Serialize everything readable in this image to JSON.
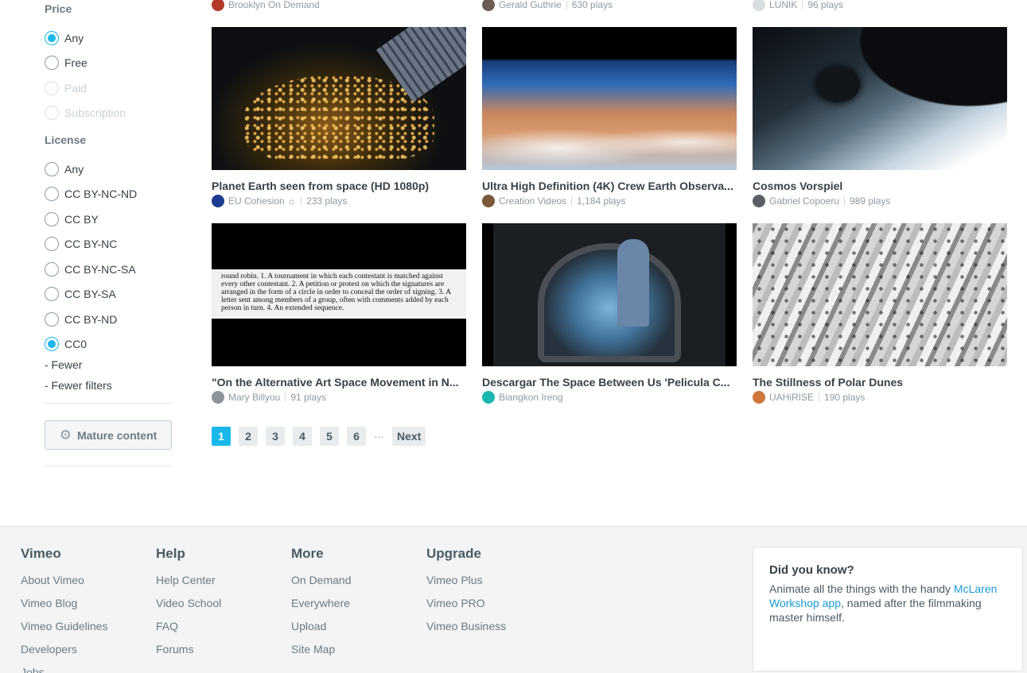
{
  "sidebar": {
    "price_title": "Price",
    "price_options": [
      "Any",
      "Free",
      "Paid",
      "Subscription"
    ],
    "license_title": "License",
    "license_options": [
      "Any",
      "CC BY-NC-ND",
      "CC BY",
      "CC BY-NC",
      "CC BY-NC-SA",
      "CC BY-SA",
      "CC BY-ND",
      "CC0"
    ],
    "fewer": "- Fewer",
    "fewer_filters": "- Fewer filters",
    "mature_button": "Mature content"
  },
  "top_row": [
    {
      "creator": "Brooklyn On Demand",
      "plays": ""
    },
    {
      "creator": "Gerald Guthrie",
      "plays": "630 plays"
    },
    {
      "creator": "LUNIK",
      "plays": "96 plays"
    }
  ],
  "videos": [
    {
      "title": "Planet Earth seen from space (HD 1080p)",
      "creator": "EU Cohesion",
      "badge": "☼",
      "plays": "233 plays"
    },
    {
      "title": "Ultra High Definition (4K) Crew Earth Observa...",
      "creator": "Creation Videos",
      "badge": "",
      "plays": "1,184 plays"
    },
    {
      "title": "Cosmos Vorspiel",
      "creator": "Gabriel Copoeru",
      "badge": "",
      "plays": "989 plays"
    },
    {
      "title": "\"On the Alternative Art Space Movement in N...",
      "creator": "Mary Billyou",
      "badge": "",
      "plays": "91 plays"
    },
    {
      "title": "Descargar The Space Between Us 'Pelicula C...",
      "creator": "Biangkon Ireng",
      "badge": "",
      "plays": ""
    },
    {
      "title": "The Stillness of Polar Dunes",
      "creator": "UAHiRISE",
      "badge": "",
      "plays": "190 plays"
    }
  ],
  "dict_text": "round robin. 1. A tournament in which each contestant is matched against every other contestant. 2. A petition or protest on which the signatures are arranged in the form of a circle in order to conceal the order of signing. 3. A letter sent among members of a group, often with comments added by each person in turn. 4. An extended sequence.",
  "pagination": {
    "pages": [
      "1",
      "2",
      "3",
      "4",
      "5",
      "6"
    ],
    "current": "1",
    "ellipsis": "···",
    "next": "Next"
  },
  "footer": {
    "vimeo": {
      "title": "Vimeo",
      "links": [
        "About Vimeo",
        "Vimeo Blog",
        "Vimeo Guidelines",
        "Developers",
        "Jobs"
      ]
    },
    "help": {
      "title": "Help",
      "links": [
        "Help Center",
        "Video School",
        "FAQ",
        "Forums"
      ]
    },
    "more": {
      "title": "More",
      "links": [
        "On Demand",
        "Everywhere",
        "Upload",
        "Site Map"
      ]
    },
    "upgrade": {
      "title": "Upgrade",
      "links": [
        "Vimeo Plus",
        "Vimeo PRO",
        "Vimeo Business"
      ]
    },
    "did_you_know": {
      "title": "Did you know?",
      "text_before": "Animate all the things with the handy ",
      "link": "McLaren Workshop app",
      "text_after": ", named after the filmmaking master himself."
    }
  },
  "colors": {
    "accent": "#1ab7ea",
    "text": "#384248",
    "muted": "#8e9aa3"
  }
}
